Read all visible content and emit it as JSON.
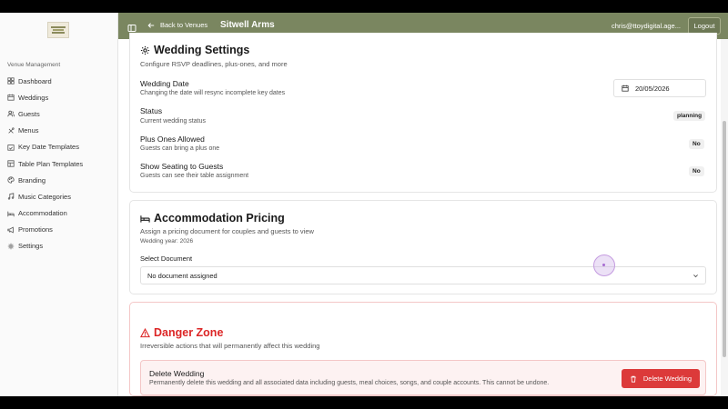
{
  "sidebar": {
    "section_label": "Venue Management",
    "items": [
      {
        "label": "Dashboard",
        "icon": "dashboard-icon"
      },
      {
        "label": "Weddings",
        "icon": "calendar-icon"
      },
      {
        "label": "Guests",
        "icon": "users-icon"
      },
      {
        "label": "Menus",
        "icon": "utensils-icon"
      },
      {
        "label": "Key Date Templates",
        "icon": "calendar-check-icon"
      },
      {
        "label": "Table Plan Templates",
        "icon": "layout-icon"
      },
      {
        "label": "Branding",
        "icon": "palette-icon"
      },
      {
        "label": "Music Categories",
        "icon": "music-icon"
      },
      {
        "label": "Accommodation",
        "icon": "bed-icon"
      },
      {
        "label": "Promotions",
        "icon": "megaphone-icon"
      },
      {
        "label": "Settings",
        "icon": "gear-icon"
      }
    ]
  },
  "header": {
    "back_label": "Back to Venues",
    "venue_name": "Sitwell Arms",
    "user_email": "chris@ttoydigital.age...",
    "logout_label": "Logout",
    "bg_color": "#7a8660"
  },
  "wedding_settings": {
    "title": "Wedding Settings",
    "description": "Configure RSVP deadlines, plus-ones, and more",
    "rows": [
      {
        "label": "Wedding Date",
        "sub": "Changing the date will resync incomplete key dates",
        "value": "20/05/2026"
      },
      {
        "label": "Status",
        "sub": "Current wedding status",
        "value": "planning"
      },
      {
        "label": "Plus Ones Allowed",
        "sub": "Guests can bring a plus one",
        "value": "No"
      },
      {
        "label": "Show Seating to Guests",
        "sub": "Guests can see their table assignment",
        "value": "No"
      }
    ]
  },
  "accommodation": {
    "title": "Accommodation Pricing",
    "description": "Assign a pricing document for couples and guests to view",
    "year_note": "Wedding year: 2026",
    "select_label": "Select Document",
    "select_value": "No document assigned"
  },
  "danger_zone": {
    "title": "Danger Zone",
    "description": "Irreversible actions that will permanently affect this wedding",
    "delete_title": "Delete Wedding",
    "delete_desc": "Permanently delete this wedding and all associated data including guests, meal choices, songs, and couple accounts. This cannot be undone.",
    "delete_button": "Delete Wedding",
    "danger_color": "#dc2626"
  }
}
